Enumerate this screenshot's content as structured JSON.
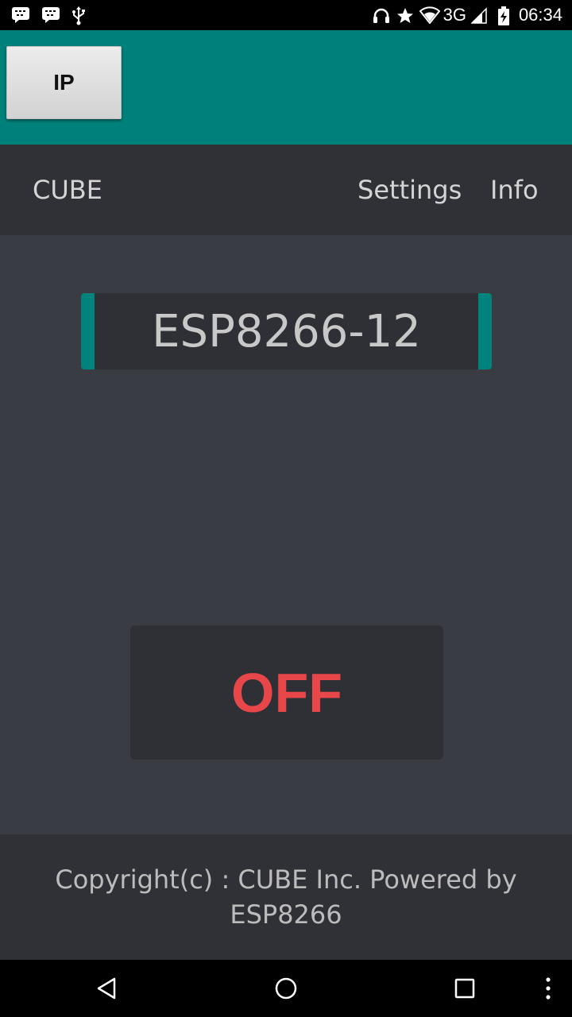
{
  "status_bar": {
    "left_icons": [
      "bbm-icon",
      "bbm-icon",
      "usb-icon"
    ],
    "right_icons": [
      "headset-icon",
      "star-icon",
      "wifi-icon",
      "signal-icon",
      "battery-charging-icon"
    ],
    "network": "3G",
    "time": "06:34"
  },
  "header": {
    "ip_button_label": "IP",
    "color": "#00807a"
  },
  "nav": {
    "brand": "CUBE",
    "settings": "Settings",
    "info": "Info"
  },
  "device": {
    "name": "ESP8266-12",
    "accent": "#00837c"
  },
  "switch": {
    "label": "OFF",
    "color": "#e8474a"
  },
  "footer": {
    "text": "Copyright(c) : CUBE Inc. Powered by ESP8266"
  },
  "system_nav": {
    "icons": [
      "back-icon",
      "home-icon",
      "recent-apps-icon",
      "overflow-menu-icon"
    ]
  }
}
